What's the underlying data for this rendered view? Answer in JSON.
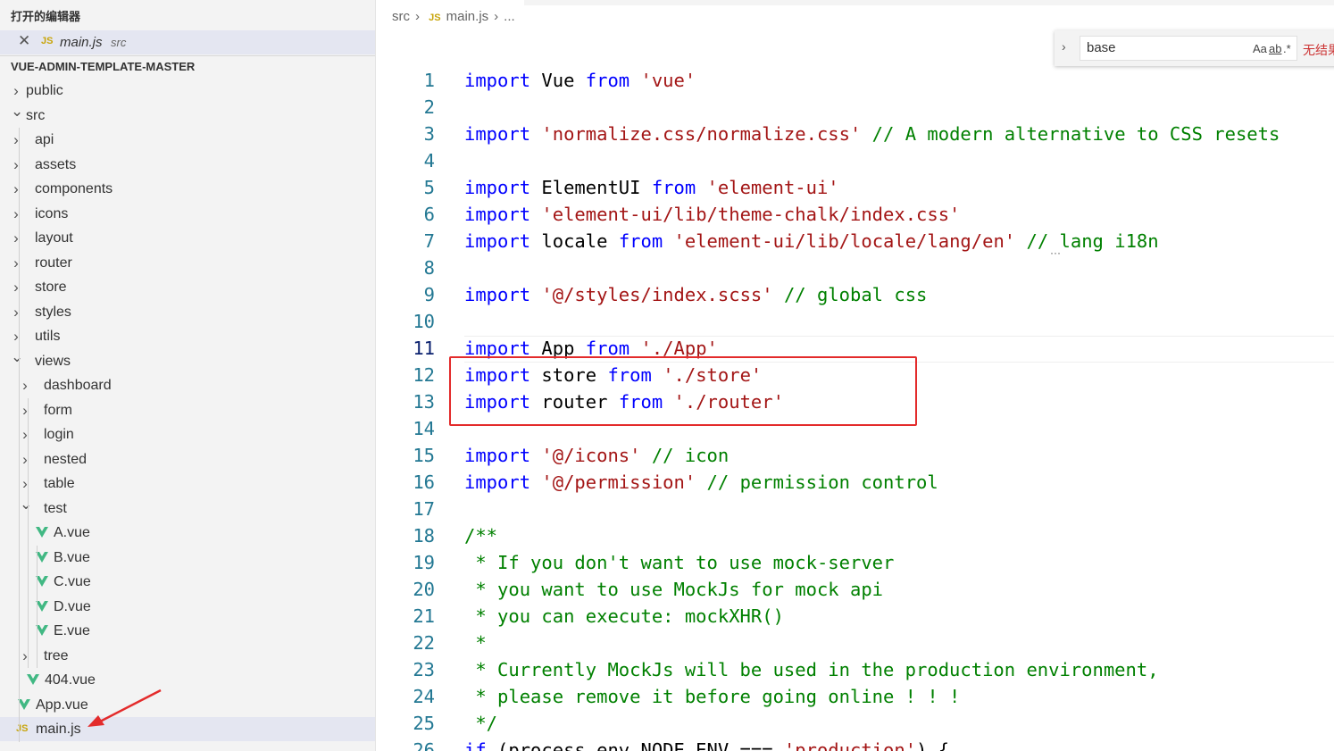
{
  "sidebar": {
    "open_editors_title": "打开的编辑器",
    "open_editor": {
      "name": "main.js",
      "path": "src",
      "icon": "js-file-icon"
    },
    "project_title": "VUE-ADMIN-TEMPLATE-MASTER",
    "tree": [
      {
        "label": "public",
        "type": "folder",
        "expanded": false,
        "depth": 0
      },
      {
        "label": "src",
        "type": "folder",
        "expanded": true,
        "depth": 0
      },
      {
        "label": "api",
        "type": "folder",
        "expanded": false,
        "depth": 1
      },
      {
        "label": "assets",
        "type": "folder",
        "expanded": false,
        "depth": 1
      },
      {
        "label": "components",
        "type": "folder",
        "expanded": false,
        "depth": 1
      },
      {
        "label": "icons",
        "type": "folder",
        "expanded": false,
        "depth": 1
      },
      {
        "label": "layout",
        "type": "folder",
        "expanded": false,
        "depth": 1
      },
      {
        "label": "router",
        "type": "folder",
        "expanded": false,
        "depth": 1
      },
      {
        "label": "store",
        "type": "folder",
        "expanded": false,
        "depth": 1
      },
      {
        "label": "styles",
        "type": "folder",
        "expanded": false,
        "depth": 1
      },
      {
        "label": "utils",
        "type": "folder",
        "expanded": false,
        "depth": 1
      },
      {
        "label": "views",
        "type": "folder",
        "expanded": true,
        "depth": 1
      },
      {
        "label": "dashboard",
        "type": "folder",
        "expanded": false,
        "depth": 2
      },
      {
        "label": "form",
        "type": "folder",
        "expanded": false,
        "depth": 2
      },
      {
        "label": "login",
        "type": "folder",
        "expanded": false,
        "depth": 2
      },
      {
        "label": "nested",
        "type": "folder",
        "expanded": false,
        "depth": 2
      },
      {
        "label": "table",
        "type": "folder",
        "expanded": false,
        "depth": 2
      },
      {
        "label": "test",
        "type": "folder",
        "expanded": true,
        "depth": 2
      },
      {
        "label": "A.vue",
        "type": "vue",
        "depth": 3
      },
      {
        "label": "B.vue",
        "type": "vue",
        "depth": 3
      },
      {
        "label": "C.vue",
        "type": "vue",
        "depth": 3
      },
      {
        "label": "D.vue",
        "type": "vue",
        "depth": 3
      },
      {
        "label": "E.vue",
        "type": "vue",
        "depth": 3
      },
      {
        "label": "tree",
        "type": "folder",
        "expanded": false,
        "depth": 2
      },
      {
        "label": "404.vue",
        "type": "vue",
        "depth": 2
      },
      {
        "label": "App.vue",
        "type": "vue",
        "depth": 1
      },
      {
        "label": "main.js",
        "type": "js",
        "depth": 1,
        "selected": true
      }
    ]
  },
  "editor": {
    "breadcrumb": {
      "folder": "src",
      "file_icon": "JS",
      "file": "main.js",
      "more": "..."
    },
    "find_widget": {
      "query": "base",
      "match_case": "Aa",
      "whole_word": "ab",
      "regex": ".*",
      "result": "无结果"
    },
    "current_line": "11",
    "lines": [
      {
        "n": "1",
        "tokens": [
          [
            "kw",
            "import"
          ],
          [
            "tx",
            " Vue "
          ],
          [
            "kw",
            "from"
          ],
          [
            "tx",
            " "
          ],
          [
            "str",
            "'vue'"
          ]
        ]
      },
      {
        "n": "2",
        "tokens": []
      },
      {
        "n": "3",
        "tokens": [
          [
            "kw",
            "import"
          ],
          [
            "tx",
            " "
          ],
          [
            "str",
            "'normalize.css/normalize.css'"
          ],
          [
            "tx",
            " "
          ],
          [
            "cm",
            "// A modern alternative to CSS resets"
          ]
        ]
      },
      {
        "n": "4",
        "tokens": []
      },
      {
        "n": "5",
        "tokens": [
          [
            "kw",
            "import"
          ],
          [
            "tx",
            " ElementUI "
          ],
          [
            "kw",
            "from"
          ],
          [
            "tx",
            " "
          ],
          [
            "str",
            "'element-ui'"
          ]
        ]
      },
      {
        "n": "6",
        "tokens": [
          [
            "kw",
            "import"
          ],
          [
            "tx",
            " "
          ],
          [
            "str",
            "'element-ui/lib/theme-chalk/index.css'"
          ]
        ]
      },
      {
        "n": "7",
        "tokens": [
          [
            "kw",
            "import"
          ],
          [
            "tx",
            " locale "
          ],
          [
            "kw",
            "from"
          ],
          [
            "tx",
            " "
          ],
          [
            "str",
            "'element-ui/lib/locale/lang/en'"
          ],
          [
            "tx",
            " "
          ],
          [
            "cm",
            "// lang i18n"
          ]
        ]
      },
      {
        "n": "8",
        "tokens": []
      },
      {
        "n": "9",
        "tokens": [
          [
            "kw",
            "import"
          ],
          [
            "tx",
            " "
          ],
          [
            "str",
            "'@/styles/index.scss'"
          ],
          [
            "tx",
            " "
          ],
          [
            "cm",
            "// global css"
          ]
        ]
      },
      {
        "n": "10",
        "tokens": []
      },
      {
        "n": "11",
        "tokens": [
          [
            "kw",
            "import"
          ],
          [
            "tx",
            " App "
          ],
          [
            "kw",
            "from"
          ],
          [
            "tx",
            " "
          ],
          [
            "str",
            "'./App'"
          ]
        ]
      },
      {
        "n": "12",
        "tokens": [
          [
            "kw",
            "import"
          ],
          [
            "tx",
            " store "
          ],
          [
            "kw",
            "from"
          ],
          [
            "tx",
            " "
          ],
          [
            "str",
            "'./store'"
          ]
        ]
      },
      {
        "n": "13",
        "tokens": [
          [
            "kw",
            "import"
          ],
          [
            "tx",
            " router "
          ],
          [
            "kw",
            "from"
          ],
          [
            "tx",
            " "
          ],
          [
            "str",
            "'./router'"
          ]
        ]
      },
      {
        "n": "14",
        "tokens": []
      },
      {
        "n": "15",
        "tokens": [
          [
            "kw",
            "import"
          ],
          [
            "tx",
            " "
          ],
          [
            "str",
            "'@/icons'"
          ],
          [
            "tx",
            " "
          ],
          [
            "cm",
            "// icon"
          ]
        ]
      },
      {
        "n": "16",
        "tokens": [
          [
            "kw",
            "import"
          ],
          [
            "tx",
            " "
          ],
          [
            "str",
            "'@/permission'"
          ],
          [
            "tx",
            " "
          ],
          [
            "cm",
            "// permission control"
          ]
        ]
      },
      {
        "n": "17",
        "tokens": []
      },
      {
        "n": "18",
        "tokens": [
          [
            "cm",
            "/**"
          ]
        ]
      },
      {
        "n": "19",
        "tokens": [
          [
            "cm",
            " * If you don't want to use mock-server"
          ]
        ]
      },
      {
        "n": "20",
        "tokens": [
          [
            "cm",
            " * you want to use MockJs for mock api"
          ]
        ]
      },
      {
        "n": "21",
        "tokens": [
          [
            "cm",
            " * you can execute: mockXHR()"
          ]
        ]
      },
      {
        "n": "22",
        "tokens": [
          [
            "cm",
            " *"
          ]
        ]
      },
      {
        "n": "23",
        "tokens": [
          [
            "cm",
            " * Currently MockJs will be used in the production environment,"
          ]
        ]
      },
      {
        "n": "24",
        "tokens": [
          [
            "cm",
            " * please remove it before going online ! ! !"
          ]
        ]
      },
      {
        "n": "25",
        "tokens": [
          [
            "cm",
            " */"
          ]
        ]
      },
      {
        "n": "26",
        "tokens": [
          [
            "kw",
            "if"
          ],
          [
            "tx",
            " (process.env.NODE_ENV === "
          ],
          [
            "str",
            "'production'"
          ],
          [
            "tx",
            ") {"
          ]
        ]
      }
    ]
  },
  "colors": {
    "keyword": "#0000ff",
    "string": "#a31515",
    "comment": "#008000",
    "annotation_box": "#e32b2b",
    "vue_icon": "#41b883",
    "js_icon": "#c8a50b"
  }
}
